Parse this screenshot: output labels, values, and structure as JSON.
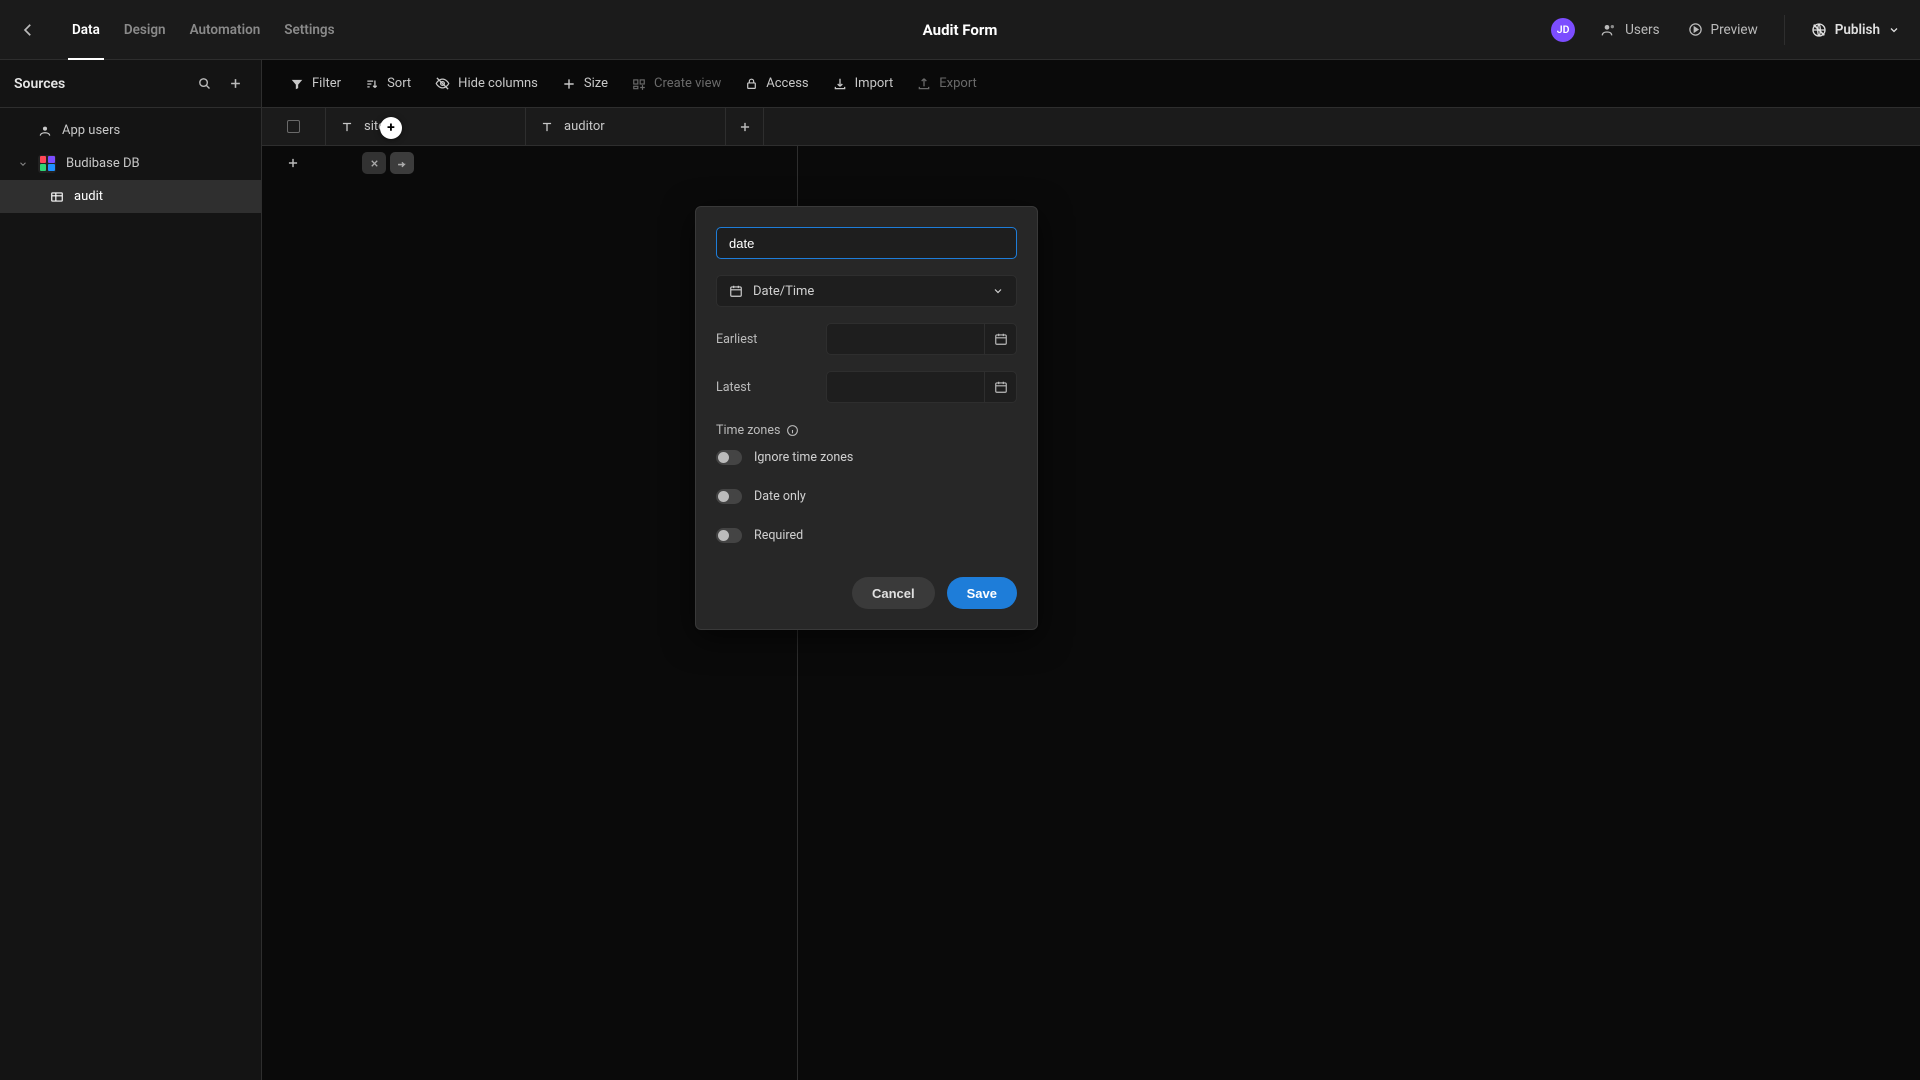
{
  "header": {
    "nav": {
      "data": "Data",
      "design": "Design",
      "automation": "Automation",
      "settings": "Settings"
    },
    "title": "Audit Form",
    "avatar_initials": "JD",
    "users": "Users",
    "preview": "Preview",
    "publish": "Publish"
  },
  "sidebar": {
    "title": "Sources",
    "items": {
      "app_users": "App users",
      "budibase_db": "Budibase DB",
      "audit": "audit"
    }
  },
  "toolbar": {
    "filter": "Filter",
    "sort": "Sort",
    "hide_columns": "Hide columns",
    "size": "Size",
    "create_view": "Create view",
    "access": "Access",
    "import": "Import",
    "export": "Export"
  },
  "columns": {
    "c1": "site",
    "c2": "auditor"
  },
  "popover": {
    "name_value": "date",
    "type_label": "Date/Time",
    "earliest_lbl": "Earliest",
    "latest_lbl": "Latest",
    "tz_section": "Time zones",
    "ignore_tz": "Ignore time zones",
    "date_only": "Date only",
    "required": "Required",
    "cancel": "Cancel",
    "save": "Save"
  }
}
